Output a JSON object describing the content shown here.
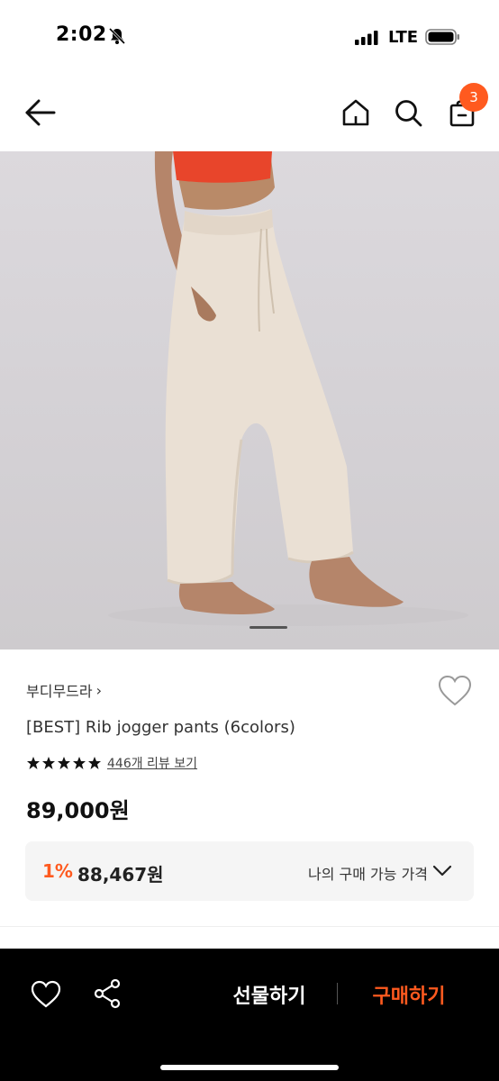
{
  "status": {
    "time": "2:02",
    "network": "LTE"
  },
  "header": {
    "cart_count": "3"
  },
  "product": {
    "brand": "부디무드라",
    "title": "[BEST] Rib jogger pants (6colors)",
    "rating_stars": 5,
    "review_link": "446개 리뷰 보기",
    "price": "89,000원",
    "discount_percent": "1%",
    "discount_price": "88,467원",
    "my_price_label": "나의 구매 가능 가격"
  },
  "bottom_bar": {
    "gift_label": "선물하기",
    "buy_label": "구매하기"
  },
  "colors": {
    "accent": "#ff5a1f",
    "bottom_bar_bg": "#000000"
  },
  "icons": [
    "bell-slash-icon",
    "signal-icon",
    "battery-icon",
    "back-arrow-icon",
    "home-icon",
    "search-icon",
    "cart-icon",
    "heart-icon",
    "star-icon",
    "chevron-down-icon",
    "share-icon"
  ]
}
